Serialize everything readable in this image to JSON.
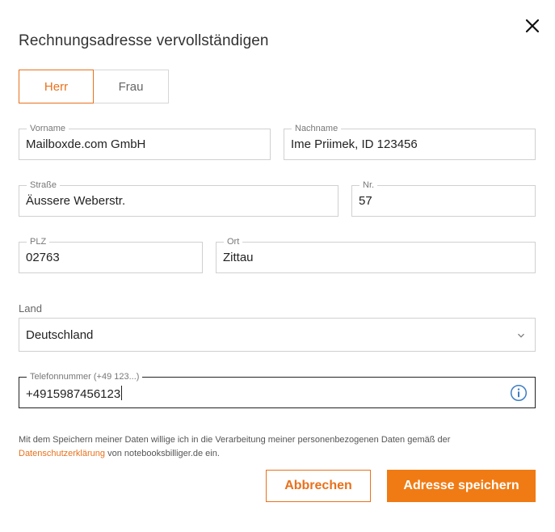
{
  "dialog": {
    "title": "Rechnungsadresse vervollständigen"
  },
  "salutation": {
    "options": [
      "Herr",
      "Frau"
    ],
    "selected": "Herr"
  },
  "fields": {
    "vorname": {
      "label": "Vorname",
      "value": "Mailboxde.com GmbH"
    },
    "nachname": {
      "label": "Nachname",
      "value": "Ime Priimek, ID 123456"
    },
    "strasse": {
      "label": "Straße",
      "value": "Äussere Weberstr."
    },
    "nr": {
      "label": "Nr.",
      "value": "57"
    },
    "plz": {
      "label": "PLZ",
      "value": "02763"
    },
    "ort": {
      "label": "Ort",
      "value": "Zittau"
    },
    "land": {
      "label": "Land",
      "value": "Deutschland"
    },
    "telefon": {
      "label": "Telefonnummer (+49 123...)",
      "value": "+4915987456123"
    }
  },
  "consent": {
    "text_before": "Mit dem Speichern meiner Daten willige ich in die Verarbeitung meiner personenbezogenen Daten gemäß der",
    "link": "Datenschutzerklärung",
    "text_after": "von notebooksbilliger.de ein."
  },
  "buttons": {
    "cancel": "Abbrechen",
    "save": "Adresse speichern"
  },
  "colors": {
    "accent": "#f07b14",
    "accent_text": "#e8711c",
    "info_icon": "#3b7dc4"
  },
  "icons": {
    "close": "close-icon",
    "chevron": "chevron-down-icon",
    "info": "info-icon"
  }
}
